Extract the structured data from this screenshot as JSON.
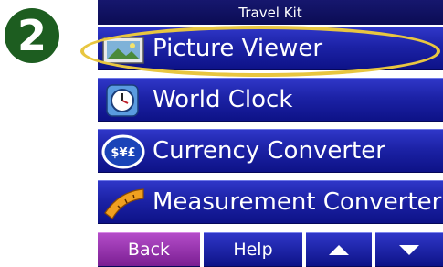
{
  "step_badge": "2",
  "window": {
    "title": "Travel Kit"
  },
  "menu": {
    "items": [
      {
        "label": "Picture Viewer",
        "icon": "picture-icon"
      },
      {
        "label": "World Clock",
        "icon": "clock-icon"
      },
      {
        "label": "Currency Converter",
        "icon": "currency-icon"
      },
      {
        "label": "Measurement Converter",
        "icon": "measuring-tape-icon"
      }
    ]
  },
  "footer": {
    "back_label": "Back",
    "help_label": "Help",
    "up_icon": "up-arrow-icon",
    "down_icon": "down-arrow-icon"
  },
  "colors": {
    "titlebar": "#0b0c54",
    "menu_button": "#1c22a6",
    "back_button": "#9a34b2",
    "highlight_ellipse": "#e8c640",
    "step_badge": "#1d5d20"
  }
}
